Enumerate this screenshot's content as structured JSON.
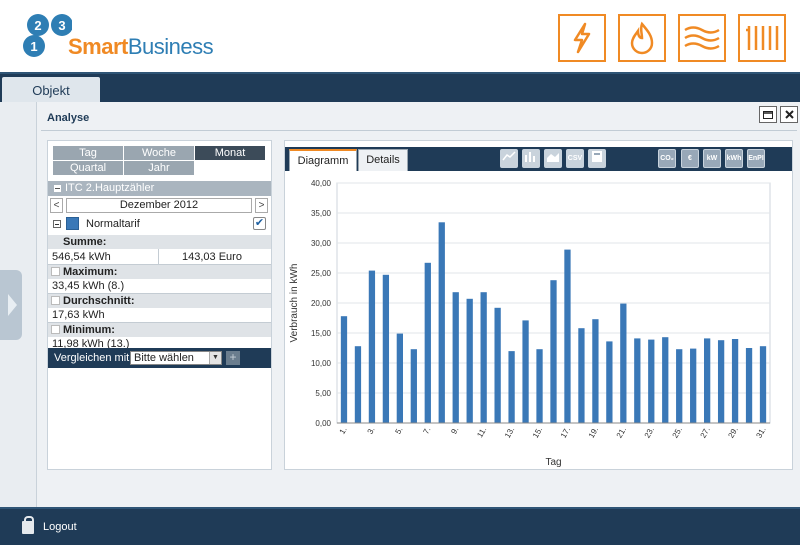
{
  "header": {
    "logo": {
      "numbers": [
        "2",
        "3",
        "1"
      ],
      "word_smart": "Smart",
      "word_business": "Business"
    },
    "utility_icons": [
      "lightning-icon",
      "flame-icon",
      "heat-waves-icon",
      "radiator-icon"
    ],
    "colors": {
      "accent": "#f08a24",
      "navy": "#1f3b57",
      "bar_blue": "#3a78b7"
    }
  },
  "nav": {
    "tab": "Objekt"
  },
  "panel": {
    "title": "Analyse",
    "periods": [
      "Tag",
      "Woche",
      "Monat",
      "Quartal",
      "Jahr"
    ],
    "active_period": "Monat",
    "counter": "ITC 2.Hauptzähler",
    "prev": "<",
    "next": ">",
    "date": "Dezember 2012",
    "tarif": "Normaltarif",
    "tarif_checked": "✔",
    "summe_label": "Summe:",
    "summe_kwh": "546,54 kWh",
    "summe_euro": "143,03 Euro",
    "maximum_label": "Maximum:",
    "maximum_value": "33,45 kWh (8.)",
    "durchschnitt_label": "Durchschnitt:",
    "durchschnitt_value": "17,63 kWh",
    "minimum_label": "Minimum:",
    "minimum_value": "11,98 kWh (13.)",
    "compare_label": "Vergleichen mit:",
    "compare_value": "Bitte wählen",
    "compare_add": "+"
  },
  "chart_tabs": [
    "Diagramm",
    "Details"
  ],
  "chart_toolbar": [
    {
      "name": "line-chart-icon",
      "text": ""
    },
    {
      "name": "bar-chart-icon",
      "text": ""
    },
    {
      "name": "area-chart-icon",
      "text": ""
    },
    {
      "name": "csv-icon",
      "text": "CSV"
    },
    {
      "name": "calculator-icon",
      "text": ""
    },
    {
      "name": "co2-icon",
      "text": "CO₂"
    },
    {
      "name": "euro-icon",
      "text": "€"
    },
    {
      "name": "kw-icon",
      "text": "kW"
    },
    {
      "name": "kwh-icon",
      "text": "kWh"
    },
    {
      "name": "enpi-icon",
      "text": "EnPI"
    }
  ],
  "footer": {
    "logout": "Logout"
  },
  "chart_data": {
    "type": "bar",
    "xlabel": "Tag",
    "ylabel": "Verbrauch in kWh",
    "ylim": [
      0,
      40
    ],
    "yticks": [
      "0,00",
      "5,00",
      "10,00",
      "15,00",
      "20,00",
      "25,00",
      "30,00",
      "35,00",
      "40,00"
    ],
    "xtick_labels": [
      "1.",
      "3.",
      "5.",
      "7.",
      "9.",
      "11.",
      "13.",
      "15.",
      "17.",
      "19.",
      "21.",
      "23.",
      "25.",
      "27.",
      "29.",
      "31."
    ],
    "categories": [
      "1",
      "2",
      "3",
      "4",
      "5",
      "6",
      "7",
      "8",
      "9",
      "10",
      "11",
      "12",
      "13",
      "14",
      "15",
      "16",
      "17",
      "18",
      "19",
      "20",
      "21",
      "22",
      "23",
      "24",
      "25",
      "26",
      "27",
      "28",
      "29",
      "30",
      "31"
    ],
    "values": [
      17.8,
      12.8,
      25.4,
      24.7,
      14.9,
      12.3,
      26.7,
      33.45,
      21.8,
      20.7,
      21.8,
      19.2,
      11.98,
      17.1,
      12.3,
      23.8,
      28.9,
      15.8,
      17.3,
      13.6,
      19.9,
      14.1,
      13.9,
      14.3,
      12.3,
      12.4,
      14.1,
      13.8,
      14.0,
      12.5,
      12.8
    ],
    "grid": true,
    "legend": "none"
  }
}
